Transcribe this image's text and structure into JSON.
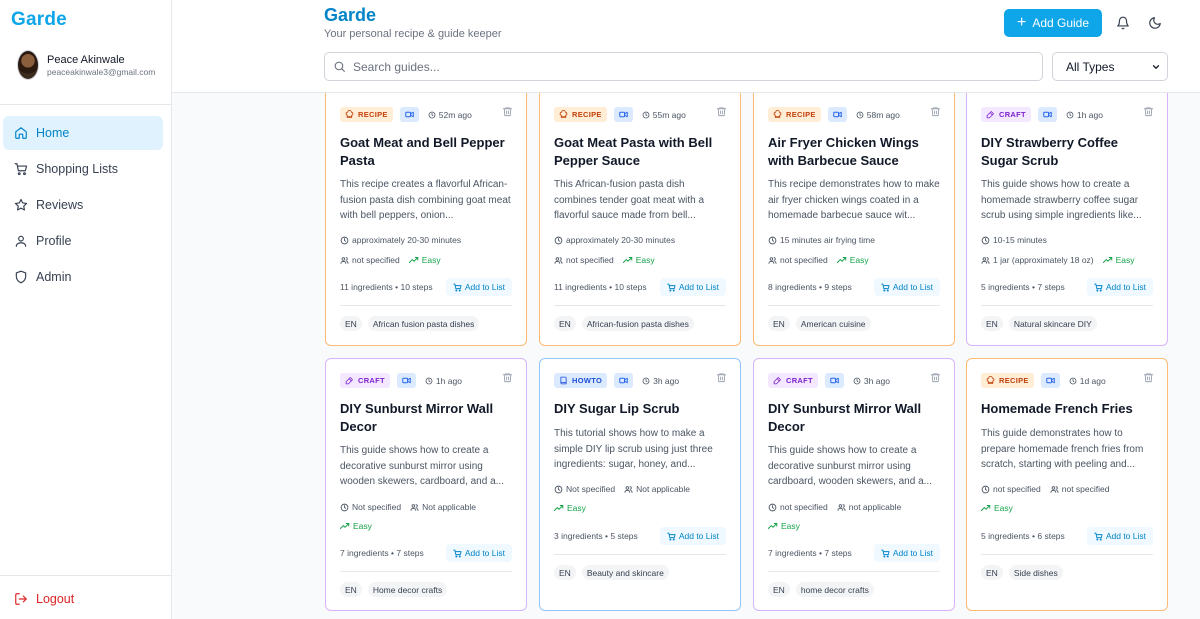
{
  "app": {
    "logo": "Garde",
    "title": "Garde",
    "subtitle": "Your personal recipe & guide keeper",
    "add_guide_label": "Add Guide"
  },
  "user": {
    "name": "Peace Akinwale",
    "email": "peaceakinwale3@gmail.com"
  },
  "nav": [
    {
      "label": "Home",
      "icon": "home-icon",
      "active": true
    },
    {
      "label": "Shopping Lists",
      "icon": "cart-icon",
      "active": false
    },
    {
      "label": "Reviews",
      "icon": "star-icon",
      "active": false
    },
    {
      "label": "Profile",
      "icon": "user-icon",
      "active": false
    },
    {
      "label": "Admin",
      "icon": "shield-icon",
      "active": false
    }
  ],
  "logout_label": "Logout",
  "search": {
    "placeholder": "Search guides..."
  },
  "type_filter": {
    "selected": "All Types"
  },
  "add_to_list_label": "Add to List",
  "colors": {
    "accent": "#0ea5e9",
    "recipe_border": "#fdba74",
    "craft_border": "#d8b4fe",
    "howto_border": "#93c5fd",
    "easy": "#16a34a",
    "logout": "#dc2626"
  },
  "cards": [
    {
      "type": "RECIPE",
      "time_ago": "52m ago",
      "title": "Goat Meat and Bell Pepper Pasta",
      "description": "This recipe creates a flavorful African-fusion pasta dish combining goat meat with bell peppers, onion...",
      "duration": "approximately 20-30 minutes",
      "serves": "not specified",
      "difficulty": "Easy",
      "counts": "11 ingredients • 10 steps",
      "tags": [
        "EN",
        "African fusion pasta dishes"
      ]
    },
    {
      "type": "RECIPE",
      "time_ago": "55m ago",
      "title": "Goat Meat Pasta with Bell Pepper Sauce",
      "description": "This African-fusion pasta dish combines tender goat meat with a flavorful sauce made from bell...",
      "duration": "approximately 20-30 minutes",
      "serves": "not specified",
      "difficulty": "Easy",
      "counts": "11 ingredients • 10 steps",
      "tags": [
        "EN",
        "African-fusion pasta dishes"
      ]
    },
    {
      "type": "RECIPE",
      "time_ago": "58m ago",
      "title": "Air Fryer Chicken Wings with Barbecue Sauce",
      "description": "This recipe demonstrates how to make air fryer chicken wings coated in a homemade barbecue sauce wit...",
      "duration": "15 minutes air frying time",
      "serves": "not specified",
      "difficulty": "Easy",
      "counts": "8 ingredients • 9 steps",
      "tags": [
        "EN",
        "American cuisine"
      ]
    },
    {
      "type": "CRAFT",
      "time_ago": "1h ago",
      "title": "DIY Strawberry Coffee Sugar Scrub",
      "description": "This guide shows how to create a homemade strawberry coffee sugar scrub using simple ingredients like...",
      "duration": "10-15 minutes",
      "serves": "1 jar (approximately 18 oz)",
      "difficulty": "Easy",
      "counts": "5 ingredients • 7 steps",
      "tags": [
        "EN",
        "Natural skincare DIY"
      ]
    },
    {
      "type": "CRAFT",
      "time_ago": "1h ago",
      "title": "DIY Sunburst Mirror Wall Decor",
      "description": "This guide shows how to create a decorative sunburst mirror using wooden skewers, cardboard, and a...",
      "duration": "Not specified",
      "serves": "Not applicable",
      "difficulty": "Easy",
      "counts": "7 ingredients • 7 steps",
      "tags": [
        "EN",
        "Home decor crafts"
      ]
    },
    {
      "type": "HOWTO",
      "time_ago": "3h ago",
      "title": "DIY Sugar Lip Scrub",
      "description": "This tutorial shows how to make a simple DIY lip scrub using just three ingredients: sugar, honey, and...",
      "duration": "Not specified",
      "serves": "Not applicable",
      "difficulty": "Easy",
      "counts": "3 ingredients • 5 steps",
      "tags": [
        "EN",
        "Beauty and skincare"
      ]
    },
    {
      "type": "CRAFT",
      "time_ago": "3h ago",
      "title": "DIY Sunburst Mirror Wall Decor",
      "description": "This guide shows how to create a decorative sunburst mirror using cardboard, wooden skewers, and a...",
      "duration": "not specified",
      "serves": "not applicable",
      "difficulty": "Easy",
      "counts": "7 ingredients • 7 steps",
      "tags": [
        "EN",
        "home decor crafts"
      ]
    },
    {
      "type": "RECIPE",
      "time_ago": "1d ago",
      "title": "Homemade French Fries",
      "description": "This guide demonstrates how to prepare homemade french fries from scratch, starting with peeling and...",
      "duration": "not specified",
      "serves": "not specified",
      "difficulty": "Easy",
      "counts": "5 ingredients • 6 steps",
      "tags": [
        "EN",
        "Side dishes"
      ]
    }
  ]
}
